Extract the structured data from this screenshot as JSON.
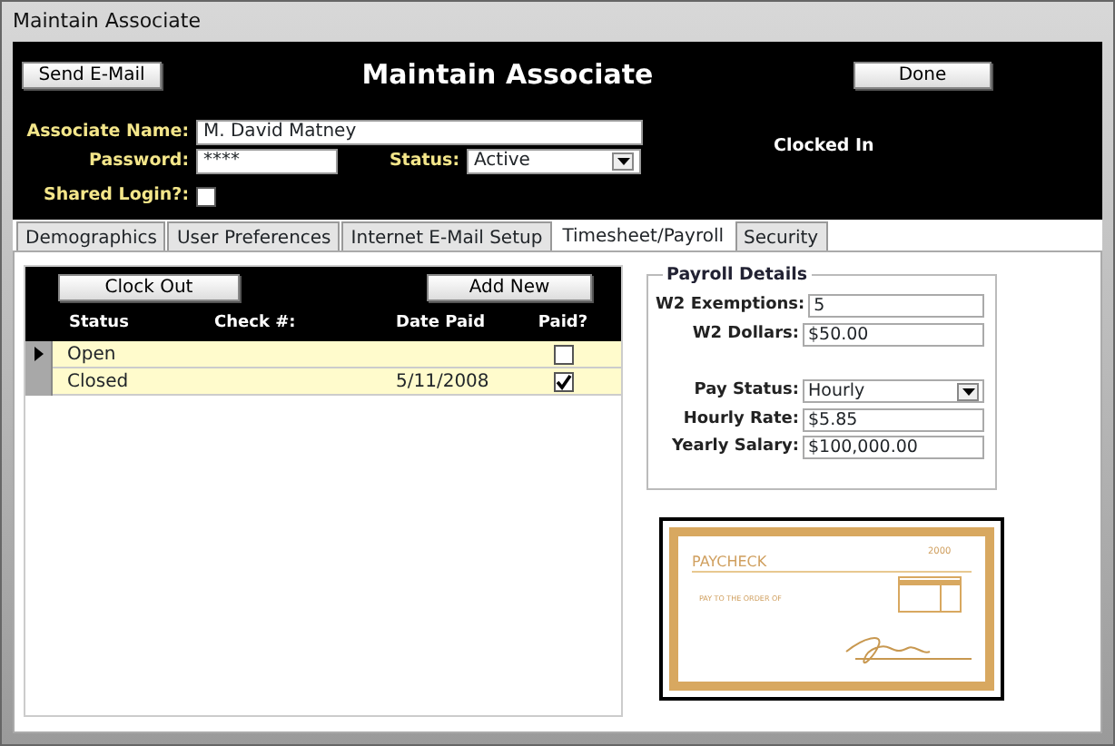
{
  "window": {
    "title": "Maintain Associate"
  },
  "header": {
    "title": "Maintain Associate",
    "send_button": "Send E-Mail",
    "done_button": "Done",
    "clock_status": "Clocked In"
  },
  "fields": {
    "name_label": "Associate Name:",
    "name_value": "M. David Matney",
    "password_label": "Password:",
    "password_value": "****",
    "status_label": "Status:",
    "status_value": "Active",
    "shared_label": "Shared Login?:",
    "shared_checked": false
  },
  "tabs": [
    {
      "label": "Demographics",
      "selected": false
    },
    {
      "label": "User Preferences",
      "selected": false
    },
    {
      "label": "Internet E-Mail Setup",
      "selected": false
    },
    {
      "label": "Timesheet/Payroll",
      "selected": true
    },
    {
      "label": "Security",
      "selected": false
    }
  ],
  "timesheet": {
    "buttons": [
      "Clock Out",
      "Add New"
    ],
    "columns": [
      "Status",
      "Check #:",
      "Date Paid",
      "Paid?"
    ],
    "rows": [
      {
        "status": "Open",
        "check": "",
        "date_paid": "",
        "paid": false,
        "current": true
      },
      {
        "status": "Closed",
        "check": "",
        "date_paid": "5/11/2008",
        "paid": true,
        "current": false
      }
    ]
  },
  "payroll": {
    "title": "Payroll Details",
    "fields": [
      {
        "label": "W2 Exemptions:",
        "value": "5",
        "kind": "text"
      },
      {
        "label": "W2 Dollars:",
        "value": "$50.00",
        "kind": "text"
      },
      {
        "label": "Pay Status:",
        "value": "Hourly",
        "kind": "select"
      },
      {
        "label": "Hourly Rate:",
        "value": "$5.85",
        "kind": "text"
      },
      {
        "label": "Yearly Salary:",
        "value": "$100,000.00",
        "kind": "text"
      }
    ]
  },
  "check_image": {
    "title": "PAYCHECK",
    "number": "2000",
    "pay_line": "PAY TO THE ORDER OF"
  }
}
